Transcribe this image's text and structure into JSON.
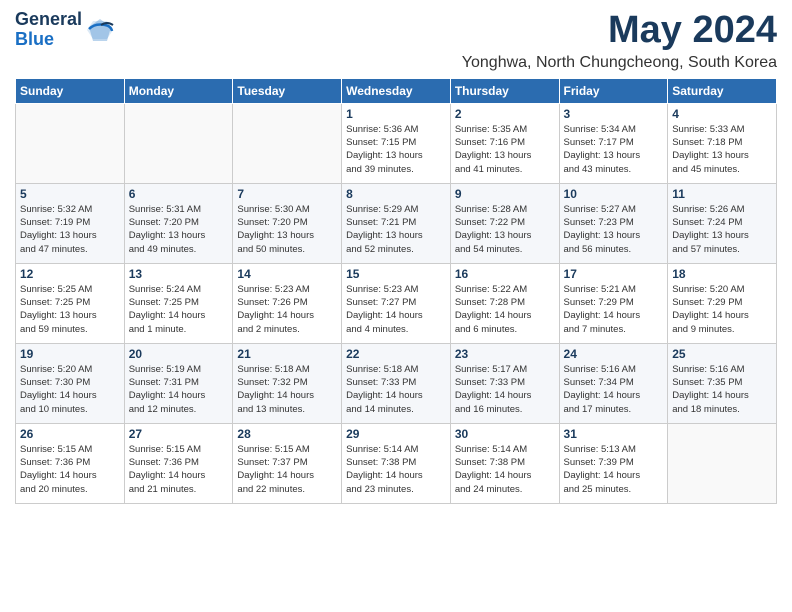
{
  "header": {
    "logo_general": "General",
    "logo_blue": "Blue",
    "month_title": "May 2024",
    "location": "Yonghwa, North Chungcheong, South Korea"
  },
  "weekdays": [
    "Sunday",
    "Monday",
    "Tuesday",
    "Wednesday",
    "Thursday",
    "Friday",
    "Saturday"
  ],
  "weeks": [
    [
      {
        "day": "",
        "info": ""
      },
      {
        "day": "",
        "info": ""
      },
      {
        "day": "",
        "info": ""
      },
      {
        "day": "1",
        "info": "Sunrise: 5:36 AM\nSunset: 7:15 PM\nDaylight: 13 hours\nand 39 minutes."
      },
      {
        "day": "2",
        "info": "Sunrise: 5:35 AM\nSunset: 7:16 PM\nDaylight: 13 hours\nand 41 minutes."
      },
      {
        "day": "3",
        "info": "Sunrise: 5:34 AM\nSunset: 7:17 PM\nDaylight: 13 hours\nand 43 minutes."
      },
      {
        "day": "4",
        "info": "Sunrise: 5:33 AM\nSunset: 7:18 PM\nDaylight: 13 hours\nand 45 minutes."
      }
    ],
    [
      {
        "day": "5",
        "info": "Sunrise: 5:32 AM\nSunset: 7:19 PM\nDaylight: 13 hours\nand 47 minutes."
      },
      {
        "day": "6",
        "info": "Sunrise: 5:31 AM\nSunset: 7:20 PM\nDaylight: 13 hours\nand 49 minutes."
      },
      {
        "day": "7",
        "info": "Sunrise: 5:30 AM\nSunset: 7:20 PM\nDaylight: 13 hours\nand 50 minutes."
      },
      {
        "day": "8",
        "info": "Sunrise: 5:29 AM\nSunset: 7:21 PM\nDaylight: 13 hours\nand 52 minutes."
      },
      {
        "day": "9",
        "info": "Sunrise: 5:28 AM\nSunset: 7:22 PM\nDaylight: 13 hours\nand 54 minutes."
      },
      {
        "day": "10",
        "info": "Sunrise: 5:27 AM\nSunset: 7:23 PM\nDaylight: 13 hours\nand 56 minutes."
      },
      {
        "day": "11",
        "info": "Sunrise: 5:26 AM\nSunset: 7:24 PM\nDaylight: 13 hours\nand 57 minutes."
      }
    ],
    [
      {
        "day": "12",
        "info": "Sunrise: 5:25 AM\nSunset: 7:25 PM\nDaylight: 13 hours\nand 59 minutes."
      },
      {
        "day": "13",
        "info": "Sunrise: 5:24 AM\nSunset: 7:25 PM\nDaylight: 14 hours\nand 1 minute."
      },
      {
        "day": "14",
        "info": "Sunrise: 5:23 AM\nSunset: 7:26 PM\nDaylight: 14 hours\nand 2 minutes."
      },
      {
        "day": "15",
        "info": "Sunrise: 5:23 AM\nSunset: 7:27 PM\nDaylight: 14 hours\nand 4 minutes."
      },
      {
        "day": "16",
        "info": "Sunrise: 5:22 AM\nSunset: 7:28 PM\nDaylight: 14 hours\nand 6 minutes."
      },
      {
        "day": "17",
        "info": "Sunrise: 5:21 AM\nSunset: 7:29 PM\nDaylight: 14 hours\nand 7 minutes."
      },
      {
        "day": "18",
        "info": "Sunrise: 5:20 AM\nSunset: 7:29 PM\nDaylight: 14 hours\nand 9 minutes."
      }
    ],
    [
      {
        "day": "19",
        "info": "Sunrise: 5:20 AM\nSunset: 7:30 PM\nDaylight: 14 hours\nand 10 minutes."
      },
      {
        "day": "20",
        "info": "Sunrise: 5:19 AM\nSunset: 7:31 PM\nDaylight: 14 hours\nand 12 minutes."
      },
      {
        "day": "21",
        "info": "Sunrise: 5:18 AM\nSunset: 7:32 PM\nDaylight: 14 hours\nand 13 minutes."
      },
      {
        "day": "22",
        "info": "Sunrise: 5:18 AM\nSunset: 7:33 PM\nDaylight: 14 hours\nand 14 minutes."
      },
      {
        "day": "23",
        "info": "Sunrise: 5:17 AM\nSunset: 7:33 PM\nDaylight: 14 hours\nand 16 minutes."
      },
      {
        "day": "24",
        "info": "Sunrise: 5:16 AM\nSunset: 7:34 PM\nDaylight: 14 hours\nand 17 minutes."
      },
      {
        "day": "25",
        "info": "Sunrise: 5:16 AM\nSunset: 7:35 PM\nDaylight: 14 hours\nand 18 minutes."
      }
    ],
    [
      {
        "day": "26",
        "info": "Sunrise: 5:15 AM\nSunset: 7:36 PM\nDaylight: 14 hours\nand 20 minutes."
      },
      {
        "day": "27",
        "info": "Sunrise: 5:15 AM\nSunset: 7:36 PM\nDaylight: 14 hours\nand 21 minutes."
      },
      {
        "day": "28",
        "info": "Sunrise: 5:15 AM\nSunset: 7:37 PM\nDaylight: 14 hours\nand 22 minutes."
      },
      {
        "day": "29",
        "info": "Sunrise: 5:14 AM\nSunset: 7:38 PM\nDaylight: 14 hours\nand 23 minutes."
      },
      {
        "day": "30",
        "info": "Sunrise: 5:14 AM\nSunset: 7:38 PM\nDaylight: 14 hours\nand 24 minutes."
      },
      {
        "day": "31",
        "info": "Sunrise: 5:13 AM\nSunset: 7:39 PM\nDaylight: 14 hours\nand 25 minutes."
      },
      {
        "day": "",
        "info": ""
      }
    ]
  ]
}
